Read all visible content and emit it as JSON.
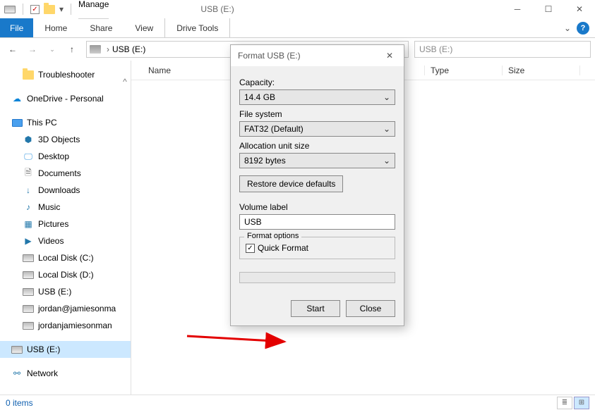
{
  "titlebar": {
    "manage": "Manage",
    "title": "USB (E:)"
  },
  "ribbon": {
    "file": "File",
    "home": "Home",
    "share": "Share",
    "view": "View",
    "drive_tools": "Drive Tools"
  },
  "nav": {
    "address": "USB (E:)",
    "search_placeholder": "USB (E:)"
  },
  "columns": {
    "name": "Name",
    "type": "Type",
    "size": "Size"
  },
  "tree": {
    "troubleshooter": "Troubleshooter",
    "onedrive": "OneDrive - Personal",
    "this_pc": "This PC",
    "objects3d": "3D Objects",
    "desktop": "Desktop",
    "documents": "Documents",
    "downloads": "Downloads",
    "music": "Music",
    "pictures": "Pictures",
    "videos": "Videos",
    "local_c": "Local Disk (C:)",
    "local_d": "Local Disk (D:)",
    "usb_e_1": "USB (E:)",
    "acct1": "jordan@jamiesonma",
    "acct2": "jordanjamiesonman",
    "usb_e_2": "USB (E:)",
    "network": "Network"
  },
  "dialog": {
    "title": "Format USB (E:)",
    "capacity_label": "Capacity:",
    "capacity_value": "14.4 GB",
    "fs_label": "File system",
    "fs_value": "FAT32 (Default)",
    "alloc_label": "Allocation unit size",
    "alloc_value": "8192 bytes",
    "restore": "Restore device defaults",
    "vol_label": "Volume label",
    "vol_value": "USB",
    "format_options": "Format options",
    "quick_format": "Quick Format",
    "start": "Start",
    "close": "Close"
  },
  "status": {
    "items": "0 items"
  }
}
